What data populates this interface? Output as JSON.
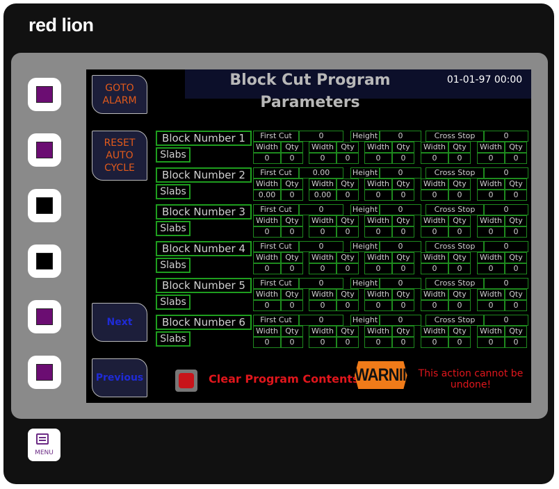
{
  "device": {
    "brand": "red lion"
  },
  "hardware_keys": [
    {
      "indicator": "purple",
      "color": "#6b0d72"
    },
    {
      "indicator": "purple",
      "color": "#6b0d72"
    },
    {
      "indicator": "black",
      "color": "#000000"
    },
    {
      "indicator": "black",
      "color": "#000000"
    },
    {
      "indicator": "purple",
      "color": "#6b0d72"
    },
    {
      "indicator": "purple",
      "color": "#6b0d72"
    }
  ],
  "menu_key": {
    "label": "MENU",
    "icon": "menu-icon"
  },
  "screen": {
    "title": "Block Cut Program Parameters",
    "clock": "01-01-97 00:00",
    "softkeys": {
      "goto_alarm": "GOTO\nALARM",
      "reset_auto_cycle": "RESET\nAUTO\nCYCLE",
      "next": "Next",
      "previous": "Previous"
    },
    "labels": {
      "first_cut": "First Cut",
      "height": "Height",
      "cross_stop": "Cross Stop",
      "width": "Width",
      "qty": "Qty",
      "slabs": "Slabs"
    },
    "blocks": [
      {
        "name": "Block Number 1",
        "first_cut": "0",
        "height": "0",
        "cross_stop": "0",
        "slabs": [
          [
            "0",
            "0"
          ],
          [
            "0",
            "0"
          ],
          [
            "0",
            "0"
          ],
          [
            "0",
            "0"
          ],
          [
            "0",
            "0"
          ]
        ]
      },
      {
        "name": "Block Number 2",
        "first_cut": "0.00",
        "height": "0",
        "cross_stop": "0",
        "slabs": [
          [
            "0.00",
            "0"
          ],
          [
            "0.00",
            "0"
          ],
          [
            "0",
            "0"
          ],
          [
            "0",
            "0"
          ],
          [
            "0",
            "0"
          ]
        ]
      },
      {
        "name": "Block Number 3",
        "first_cut": "0",
        "height": "0",
        "cross_stop": "0",
        "slabs": [
          [
            "0",
            "0"
          ],
          [
            "0",
            "0"
          ],
          [
            "0",
            "0"
          ],
          [
            "0",
            "0"
          ],
          [
            "0",
            "0"
          ]
        ]
      },
      {
        "name": "Block Number 4",
        "first_cut": "0",
        "height": "0",
        "cross_stop": "0",
        "slabs": [
          [
            "0",
            "0"
          ],
          [
            "0",
            "0"
          ],
          [
            "0",
            "0"
          ],
          [
            "0",
            "0"
          ],
          [
            "0",
            "0"
          ]
        ]
      },
      {
        "name": "Block Number 5",
        "first_cut": "0",
        "height": "0",
        "cross_stop": "0",
        "slabs": [
          [
            "0",
            "0"
          ],
          [
            "0",
            "0"
          ],
          [
            "0",
            "0"
          ],
          [
            "0",
            "0"
          ],
          [
            "0",
            "0"
          ]
        ]
      },
      {
        "name": "Block Number 6",
        "first_cut": "0",
        "height": "0",
        "cross_stop": "0",
        "slabs": [
          [
            "0",
            "0"
          ],
          [
            "0",
            "0"
          ],
          [
            "0",
            "0"
          ],
          [
            "0",
            "0"
          ],
          [
            "0",
            "0"
          ]
        ]
      }
    ],
    "clear_program": {
      "label": "Clear Program Contents",
      "icon": "red-button-icon",
      "color": "#c8141a"
    },
    "warning": {
      "badge": "WARNING",
      "text": "This action cannot be undone!",
      "color": "#f07b19"
    }
  }
}
